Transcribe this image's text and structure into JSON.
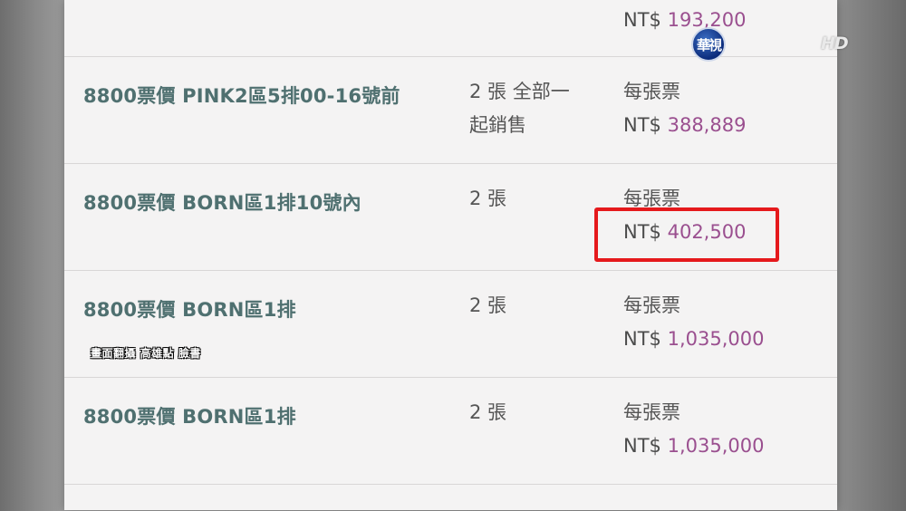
{
  "broadcast": {
    "logo_text": "華視",
    "hd_badge": "HD",
    "caption": "畫面翻攝 高雄點 臉書"
  },
  "listing": {
    "top_partial": {
      "currency": "NT$",
      "amount": "193,200"
    },
    "rows": [
      {
        "name": "8800票價 PINK2區5排00-16號前",
        "qty_line1": "2 張 全部一",
        "qty_line2": "起銷售",
        "price_label": "每張票",
        "currency": "NT$",
        "amount": "388,889"
      },
      {
        "name": "8800票價 BORN區1排10號內",
        "qty_line1": "2 張",
        "qty_line2": "",
        "price_label": "每張票",
        "currency": "NT$",
        "amount": "402,500"
      },
      {
        "name": "8800票價 BORN區1排",
        "qty_line1": "2 張",
        "qty_line2": "",
        "price_label": "每張票",
        "currency": "NT$",
        "amount": "1,035,000"
      },
      {
        "name": "8800票價 BORN區1排",
        "qty_line1": "2 張",
        "qty_line2": "",
        "price_label": "每張票",
        "currency": "NT$",
        "amount": "1,035,000"
      }
    ]
  },
  "colors": {
    "ticket_name": "#4f7070",
    "amount": "#9a4f8f",
    "highlight": "#e5191c"
  }
}
